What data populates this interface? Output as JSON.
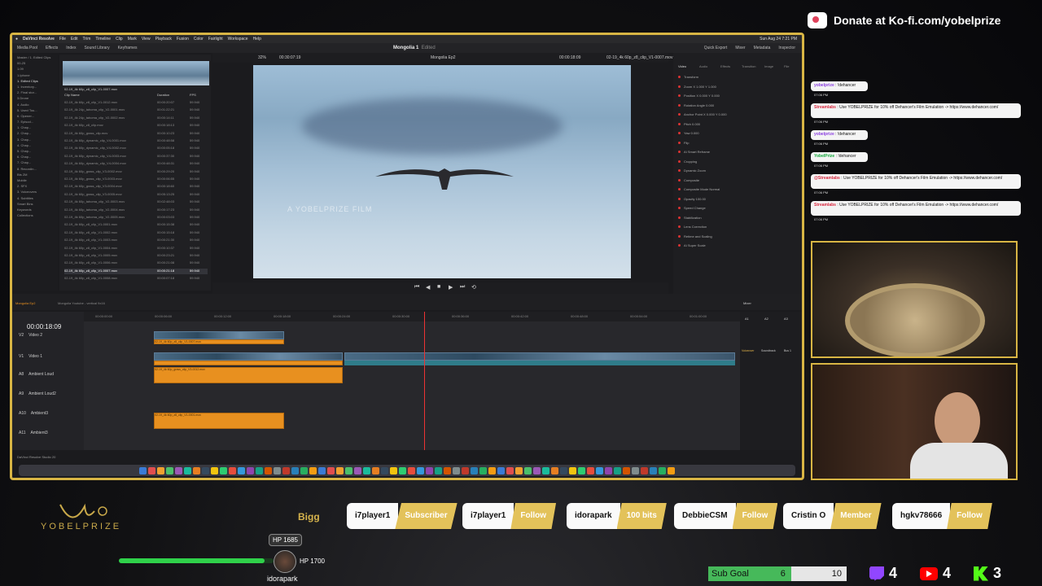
{
  "overlay": {
    "donate_text": "Donate at Ko-fi.com/yobelprize",
    "brand": "YOBELPRIZE",
    "banner_word": "Bigg"
  },
  "menubar": {
    "app": "DaVinci Resolve",
    "items": [
      "File",
      "Edit",
      "Trim",
      "Timeline",
      "Clip",
      "Mark",
      "View",
      "Playback",
      "Fusion",
      "Color",
      "Fairlight",
      "Workspace",
      "Help"
    ],
    "datetime": "Sun Aug 24  7:21 PM"
  },
  "toolbar": {
    "items": [
      "Media Pool",
      "Effects",
      "Index",
      "Sound Library",
      "Keyframes"
    ],
    "project_title": "Mongolia 1",
    "project_state": "Edited",
    "right_items": [
      "Quick Export",
      "Mixer",
      "Metadata",
      "Inspector"
    ]
  },
  "mediapool": {
    "sidebar": [
      "Master / 1. Edited Clips",
      "00-25",
      "1.09",
      "1.Iphone",
      "1. Edited Clips",
      "1. Inventory...",
      "2. Final stor...",
      "3.Drone",
      "4. Audio",
      "5. Used Tou...",
      "6. Opener...",
      "7. Episod...",
      "1. Chap...",
      "2. Chap...",
      "3. Chap...",
      "4. Chap...",
      "5. Chap...",
      "6. Chap...",
      "7. Chap...",
      "8. Recordin...",
      "Bts 2M",
      "Mobile",
      "2. SFX",
      "3. Voiceovers",
      "4. Subtitles",
      "Smart Bins",
      "Keywords",
      "Collections"
    ],
    "selected_thumb": "02-19_4k 60p_z8_clip_V1-0007.mov",
    "columns": [
      "Clip Name",
      "Duration",
      "FPS"
    ],
    "clips": [
      {
        "name": "02-19_4k 60p_z8_clip_V1-0012.mov",
        "dur": "00:00:20:07",
        "fps": "59.940"
      },
      {
        "name": "02-19_4k 24p_tahoma_clip_V2-0001.mov",
        "dur": "00:01:22:21",
        "fps": "59.940"
      },
      {
        "name": "02-19_4k 24p_tahoma_clip_V2-0002.mov",
        "dur": "00:00:14:11",
        "fps": "59.940"
      },
      {
        "name": "02-19_4k 60p_z8_clip.mov",
        "dur": "00:00:18:13",
        "fps": "59.940"
      },
      {
        "name": "02-19_4k 60p_grass_clip.mov",
        "dur": "00:00:10:23",
        "fps": "59.940"
      },
      {
        "name": "02-19_4k 60p_dynamic_clip_V4-0001.mov",
        "dur": "00:00:48:58",
        "fps": "59.940"
      },
      {
        "name": "02-19_4k 60p_dynamic_clip_V4-0002.mov",
        "dur": "00:00:05:18",
        "fps": "59.940"
      },
      {
        "name": "02-19_4k 60p_dynamic_clip_V4-0003.mov",
        "dur": "00:00:37:30",
        "fps": "59.940"
      },
      {
        "name": "02-19_4k 60p_dynamic_clip_V4-0004.mov",
        "dur": "00:00:48:31",
        "fps": "59.940"
      },
      {
        "name": "02-19_4k 60p_grass_clip_V3-0002.mov",
        "dur": "00:00:29:20",
        "fps": "59.940"
      },
      {
        "name": "02-19_4k 60p_grass_clip_V3-0003.mov",
        "dur": "00:00:06:55",
        "fps": "59.940"
      },
      {
        "name": "02-19_4k 60p_grass_clip_V3-0004.mov",
        "dur": "00:00:18:60",
        "fps": "59.940"
      },
      {
        "name": "02-19_4k 60p_grass_clip_V3-0005.mov",
        "dur": "00:05:13:25",
        "fps": "59.940"
      },
      {
        "name": "02-19_4k 60p_tahoma_clip_V2-0003.mov",
        "dur": "00:02:48:03",
        "fps": "59.940"
      },
      {
        "name": "02-19_4k 60p_tahoma_clip_V2-0004.mov",
        "dur": "00:00:17:23",
        "fps": "59.940"
      },
      {
        "name": "02-19_4k 60p_tahoma_clip_V2-0005.mov",
        "dur": "00:00:03:03",
        "fps": "59.940"
      },
      {
        "name": "02-19_4k 60p_z8_clip_V1-0001.mov",
        "dur": "00:00:15:38",
        "fps": "59.940"
      },
      {
        "name": "02-19_4k 60p_z8_clip_V1-0002.mov",
        "dur": "00:00:15:18",
        "fps": "59.940"
      },
      {
        "name": "02-19_4k 60p_z8_clip_V1-0003.mov",
        "dur": "00:00:21:30",
        "fps": "59.940"
      },
      {
        "name": "02-19_4k 60p_z8_clip_V1-0004.mov",
        "dur": "00:00:10:37",
        "fps": "59.940"
      },
      {
        "name": "02-19_4k 60p_z8_clip_V1-0005.mov",
        "dur": "00:00:23:21",
        "fps": "59.940"
      },
      {
        "name": "02-19_4k 60p_z8_clip_V1-0006.mov",
        "dur": "00:00:21:08",
        "fps": "59.940"
      },
      {
        "name": "02-19_4k 60p_z8_clip_V1-0007.mov",
        "dur": "00:00:21:18",
        "fps": "59.940"
      },
      {
        "name": "02-19_4k 60p_z8_clip_V1-0008.mov",
        "dur": "00:00:07:18",
        "fps": "59.940"
      }
    ]
  },
  "viewer": {
    "zoom": "32%",
    "source_tc": "00:30:07:19",
    "timeline_name": "Mongolia Ep2",
    "record_tc": "00:00:18:09",
    "clip_name": "02-19_4k 60p_z8_clip_V1-0007.mov",
    "watermark": "A YOBELPRIZE FILM"
  },
  "inspector": {
    "tabs": [
      "Video",
      "Audio",
      "Effects",
      "Transition",
      "Image",
      "File"
    ],
    "rows": [
      "Transform",
      "Zoom  X 1.000  Y 1.000",
      "Position  X 0.000  Y 0.000",
      "Rotation Angle  0.000",
      "Anchor Point  X 0.000  Y 0.000",
      "Pitch  0.000",
      "Yaw  0.000",
      "Flip",
      "AI Smart Reframe",
      "Cropping",
      "Dynamic Zoom",
      "Composite",
      "Composite Mode  Normal",
      "Opacity  100.00",
      "Speed Change",
      "Stabilization",
      "Lens Correction",
      "Retime and Scaling",
      "AI Super Scale"
    ]
  },
  "timeline": {
    "timecode": "00:00:18:09",
    "tabs": [
      "Mongolia Ep2",
      "Mongolia Youtube - vertical 9x16"
    ],
    "ruler": [
      "00:00:00:00",
      "00:00:06:00",
      "00:00:12:00",
      "00:00:18:00",
      "00:00:24:00",
      "00:00:30:00",
      "00:00:36:00",
      "00:00:42:00",
      "00:00:48:00",
      "00:00:54:00",
      "00:01:00:00"
    ],
    "tracks": [
      {
        "id": "V2",
        "name": "Video 2"
      },
      {
        "id": "V1",
        "name": "Video 1"
      },
      {
        "id": "A8",
        "name": "Ambient Loud"
      },
      {
        "id": "A9",
        "name": "Ambient Loud2"
      },
      {
        "id": "A10",
        "name": "Ambient3"
      },
      {
        "id": "A11",
        "name": "Ambient3"
      }
    ],
    "clips": {
      "v2": "02-19_4k 60p_z8_clip_V1-0007.mov",
      "a8": "02-19_4k 60p_grass_clip_V3-0012.mov",
      "a10": "02-19_4k 60p_z8_clip_V1-0001.mov"
    },
    "mixer_label": "Mixer",
    "mixer_channels": [
      "A1",
      "A2",
      "A3"
    ],
    "mixer_buses": [
      "Voiceover",
      "Soundtrack",
      "Bus 1"
    ],
    "studio_label": "DaVinci Resolve Studio 20"
  },
  "chat": [
    {
      "user": "yobelprize",
      "color": "u-yb",
      "text": "!dehancer",
      "time": "07:06 PM"
    },
    {
      "user": "Streamlabs",
      "color": "u-st",
      "text": "Use YOBELPRIZE for 10% off Dehancer's Film Emulation -> https://www.dehancer.com/",
      "time": "07:06 PM"
    },
    {
      "user": "yobelprize",
      "color": "u-yb",
      "text": "!dehancer",
      "time": "07:06 PM"
    },
    {
      "user": "YobelPrize",
      "color": "u-yv",
      "text": "!dehancer",
      "time": "07:06 PM"
    },
    {
      "user": "@Streamlabs",
      "color": "u-st",
      "text": "Use YOBELPRIZE for 10% off Dehancer's Film Emulation -> https://www.dehancer.com/",
      "time": "07:06 PM"
    },
    {
      "user": "Streamlabs",
      "color": "u-st",
      "text": "Use YOBELPRIZE for 10% off Dehancer's Film Emulation -> https://www.dehancer.com/",
      "time": "07:06 PM"
    }
  ],
  "alerts": [
    {
      "name": "i7player1",
      "type": "Subscriber"
    },
    {
      "name": "i7player1",
      "type": "Follow"
    },
    {
      "name": "idorapark",
      "type": "100 bits"
    },
    {
      "name": "DebbieCSM",
      "type": "Follow"
    },
    {
      "name": "Cristin O",
      "type": "Member"
    },
    {
      "name": "hgkv78666",
      "type": "Follow"
    }
  ],
  "hp": {
    "top": "HP 1685",
    "bottom": "HP 1700",
    "user": "idorapark",
    "fill_fraction": 0.94
  },
  "subgoal": {
    "label": "Sub Goal",
    "current": "6",
    "target": "10"
  },
  "platform_counts": {
    "twitch": "4",
    "youtube": "4",
    "kick": "3"
  },
  "colors": {
    "frame_gold": "#d8b544",
    "accent_green": "#46b95a",
    "playhead": "#e33333",
    "clip_orange": "#e8901f"
  }
}
